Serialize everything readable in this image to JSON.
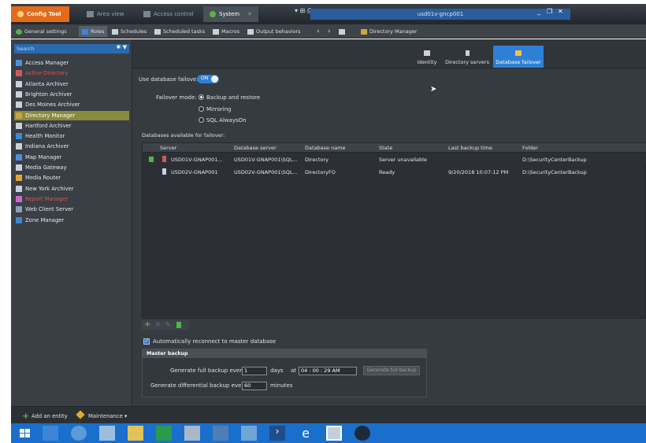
{
  "titlebar": {
    "tabs": [
      {
        "label": "Config Tool"
      },
      {
        "label": "Area view"
      },
      {
        "label": "Access control"
      },
      {
        "label": "System"
      }
    ],
    "window_title": "usd01v-gncp001",
    "controls": [
      "_",
      "❐",
      "✕"
    ]
  },
  "toolbar": {
    "items": [
      {
        "label": "General settings"
      },
      {
        "label": "Roles"
      },
      {
        "label": "Schedules"
      },
      {
        "label": "Scheduled tasks"
      },
      {
        "label": "Macros"
      },
      {
        "label": "Output behaviors"
      }
    ],
    "breadcrumb": "Directory Manager"
  },
  "sidebar": {
    "search_placeholder": "Search",
    "items": [
      {
        "label": "Access Manager",
        "color": "#e8e8e8"
      },
      {
        "label": "Active Directory",
        "color": "#e05252"
      },
      {
        "label": "Atlanta Archiver",
        "color": "#e8e8e8"
      },
      {
        "label": "Brighton Archiver",
        "color": "#e8e8e8"
      },
      {
        "label": "Des Moines Archiver",
        "color": "#e8e8e8"
      },
      {
        "label": "Directory Manager",
        "color": "#ffffff"
      },
      {
        "label": "Hartford Archiver",
        "color": "#e8e8e8"
      },
      {
        "label": "Health Monitor",
        "color": "#e8e8e8"
      },
      {
        "label": "Indiana Archiver",
        "color": "#e8e8e8"
      },
      {
        "label": "Map Manager",
        "color": "#e8e8e8"
      },
      {
        "label": "Media Gateway",
        "color": "#e8e8e8"
      },
      {
        "label": "Media Router",
        "color": "#e8e8e8"
      },
      {
        "label": "New York Archiver",
        "color": "#e8e8e8"
      },
      {
        "label": "Report Manager",
        "color": "#e05252"
      },
      {
        "label": "Web Client Server",
        "color": "#e8e8e8"
      },
      {
        "label": "Zone Manager",
        "color": "#e8e8e8"
      }
    ]
  },
  "main": {
    "tabs": [
      {
        "label": "Identity"
      },
      {
        "label": "Directory servers"
      },
      {
        "label": "Database failover"
      }
    ],
    "use_failover_label": "Use database failover:",
    "toggle_label": "ON",
    "failover_mode_label": "Failover mode:",
    "modes": [
      {
        "label": "Backup and restore",
        "selected": true
      },
      {
        "label": "Mirroring",
        "selected": false
      },
      {
        "label": "SQL AlwaysOn",
        "selected": false
      }
    ],
    "databases_label": "Databases available for failover:",
    "table": {
      "columns": [
        "Server",
        "Database server",
        "Database name",
        "State",
        "Last backup time",
        "Folder"
      ],
      "rows": [
        {
          "server": "USD01V-GNAP001...",
          "db_server": "USD01V-GNAP001\\SQL...",
          "db_name": "Directory",
          "state": "Server unavailable",
          "last_backup": "",
          "folder": "D:\\SecurityCenterBackup"
        },
        {
          "server": "USD02V-GNAP001",
          "db_server": "USD02V-GNAP001\\SQL...",
          "db_name": "DirectoryFO",
          "state": "Ready",
          "last_backup": "9/20/2018 10:07:12 PM",
          "folder": "D:\\SecurityCenterBackup"
        }
      ]
    },
    "auto_reconnect_label": "Automatically reconnect to master database",
    "master_backup": {
      "title": "Master backup",
      "full_label": "Generate full backup every:",
      "full_value": "1",
      "days_label": "days",
      "at_label": "at",
      "time_value": "04 : 00 : 29 AM",
      "generate_button": "Generate full backup",
      "diff_label": "Generate differential backup every:",
      "diff_value": "60",
      "minutes_label": "minutes"
    }
  },
  "statusbar": {
    "add_entity": "Add an entity",
    "maintenance": "Maintenance ▾"
  }
}
